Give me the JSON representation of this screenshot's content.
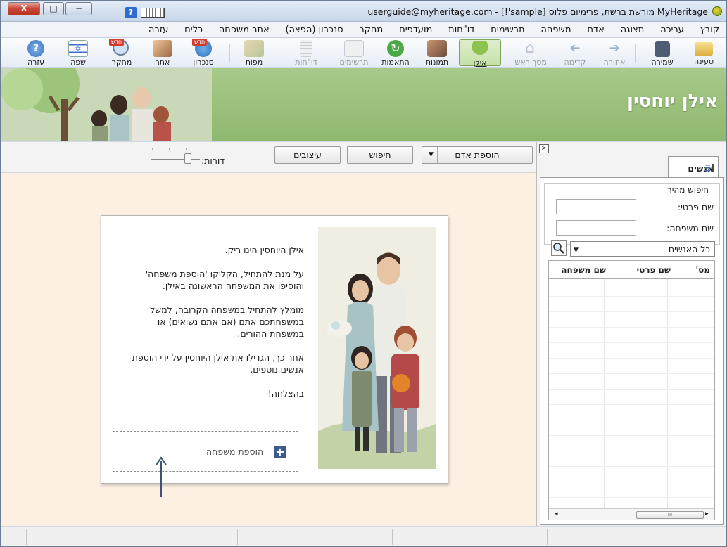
{
  "window": {
    "title": "MyHeritage מורשת ברשת, פרימיום פלוס [sample'!] - userguide@myheritage.com",
    "close": "X",
    "maximize": "□",
    "minimize": "−"
  },
  "menu": [
    "קובץ",
    "עריכה",
    "תצוגה",
    "אדם",
    "משפחה",
    "תרשימים",
    "דו\"חות",
    "מועדפים",
    "מחקר",
    "סנכרון (הפצה)",
    "אתר משפחה",
    "כלים",
    "עזרה"
  ],
  "toolbar": {
    "open": "טעינה",
    "save": "שמירה",
    "back": "אחורה",
    "forward": "קדימה",
    "home": "מסך ראשי",
    "tree": "אילן",
    "photos": "תמונות",
    "matches": "התאמות",
    "charts": "תרשימים",
    "reports": "דו\"חות",
    "maps": "מפות",
    "sync": "סנכרון",
    "site": "אתר",
    "research": "מחקר",
    "language": "שפה",
    "help": "עזרה",
    "new_badge": "חדש"
  },
  "banner": {
    "title": "אילן יוחסין"
  },
  "subtoolbar": {
    "add_person": "הוספת אדם",
    "search": "חיפוש",
    "styles": "עיצובים",
    "generations": "דורות:"
  },
  "card": {
    "p1": "אילן היוחסין הינו ריק.",
    "p2": "על מנת להתחיל, הקליקו 'הוספת משפחה' והוסיפו את המשפחה הראשונה באילן.",
    "p3": "מומלץ להתחיל במשפחה הקרובה, למשל במשפחתכם אתם (אם אתם נשואים) או במשפחת ההורים.",
    "p4": "אחר כך, הגדילו את אילן היוחסין על ידי הוספת אנשים נוספים.",
    "p5": "בהצלחה!",
    "add_family": "הוספת משפחה"
  },
  "people_panel": {
    "tab": "אנשים",
    "quick_search": "חיפוש מהיר",
    "first_name": "שם פרטי:",
    "last_name": "שם משפחה:",
    "filter": "כל האנשים",
    "col_no": "מס'",
    "col_first": "שם פרטי",
    "col_last": "שם משפחה",
    "collapse": ">"
  },
  "colors": {
    "banner": "#a7c98a",
    "canvas": "#fdf0e2",
    "accent": "#3a5b8c"
  }
}
